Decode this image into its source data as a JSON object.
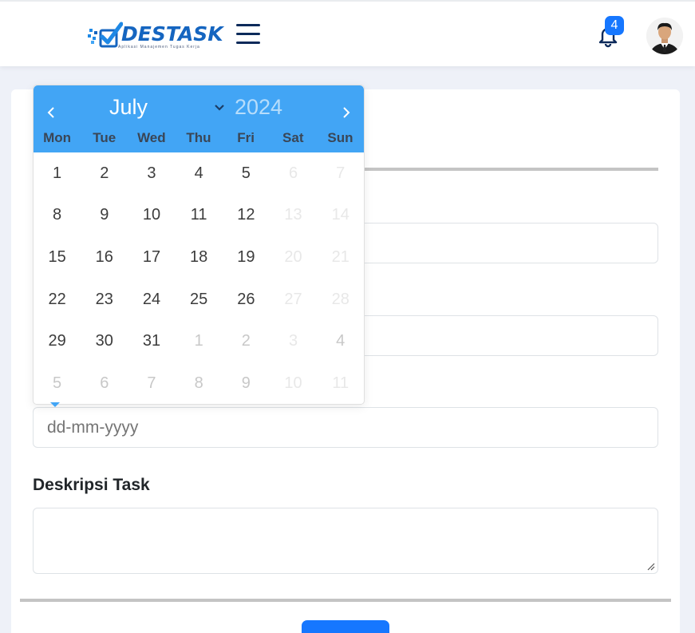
{
  "header": {
    "logo_text": "DESTASK",
    "logo_tagline": "Aplikasi Manajemen Tugas Kerja",
    "notification_count": "4",
    "brand_color": "#1565c0",
    "accent_color": "#1677ff"
  },
  "form": {
    "date_placeholder": "dd-mm-yyyy",
    "description_label": "Deskripsi Task"
  },
  "datepicker": {
    "month": "July",
    "year": "2024",
    "header_color": "#42a5f5",
    "weekdays": [
      "Mon",
      "Tue",
      "Wed",
      "Thu",
      "Fri",
      "Sat",
      "Sun"
    ],
    "days": [
      {
        "label": "1",
        "state": "normal"
      },
      {
        "label": "2",
        "state": "normal"
      },
      {
        "label": "3",
        "state": "normal"
      },
      {
        "label": "4",
        "state": "normal"
      },
      {
        "label": "5",
        "state": "normal"
      },
      {
        "label": "6",
        "state": "disabled"
      },
      {
        "label": "7",
        "state": "disabled"
      },
      {
        "label": "8",
        "state": "normal"
      },
      {
        "label": "9",
        "state": "normal"
      },
      {
        "label": "10",
        "state": "normal"
      },
      {
        "label": "11",
        "state": "normal"
      },
      {
        "label": "12",
        "state": "normal"
      },
      {
        "label": "13",
        "state": "disabled"
      },
      {
        "label": "14",
        "state": "disabled"
      },
      {
        "label": "15",
        "state": "normal"
      },
      {
        "label": "16",
        "state": "normal"
      },
      {
        "label": "17",
        "state": "normal"
      },
      {
        "label": "18",
        "state": "normal"
      },
      {
        "label": "19",
        "state": "normal"
      },
      {
        "label": "20",
        "state": "disabled"
      },
      {
        "label": "21",
        "state": "disabled"
      },
      {
        "label": "22",
        "state": "normal"
      },
      {
        "label": "23",
        "state": "normal"
      },
      {
        "label": "24",
        "state": "normal"
      },
      {
        "label": "25",
        "state": "normal"
      },
      {
        "label": "26",
        "state": "normal"
      },
      {
        "label": "27",
        "state": "disabled"
      },
      {
        "label": "28",
        "state": "disabled"
      },
      {
        "label": "29",
        "state": "normal"
      },
      {
        "label": "30",
        "state": "normal"
      },
      {
        "label": "31",
        "state": "normal"
      },
      {
        "label": "1",
        "state": "next-month"
      },
      {
        "label": "2",
        "state": "next-month"
      },
      {
        "label": "3",
        "state": "disabled"
      },
      {
        "label": "4",
        "state": "next-month"
      },
      {
        "label": "5",
        "state": "next-month"
      },
      {
        "label": "6",
        "state": "next-month"
      },
      {
        "label": "7",
        "state": "next-month"
      },
      {
        "label": "8",
        "state": "next-month"
      },
      {
        "label": "9",
        "state": "next-month"
      },
      {
        "label": "10",
        "state": "disabled"
      },
      {
        "label": "11",
        "state": "disabled"
      }
    ]
  }
}
